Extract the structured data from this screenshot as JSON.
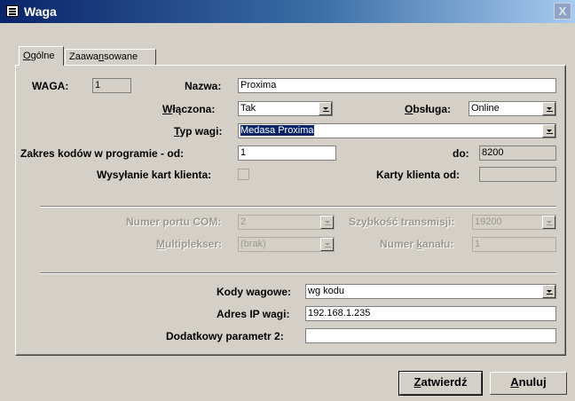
{
  "window": {
    "title": "Waga",
    "close_glyph": "X",
    "app_icon": "form-icon"
  },
  "tabs": [
    {
      "label": "Ogólne",
      "underline": "O",
      "rest": "gólne",
      "active": true
    },
    {
      "label": "Zaawansowane",
      "pre": "Zaawa",
      "underline": "n",
      "post": "sowane",
      "active": false
    }
  ],
  "general": {
    "waga_label": "WAGA:",
    "waga_value": "1",
    "nazwa_label": "Nazwa:",
    "nazwa_value": "Proxima",
    "wlaczona_label": "Włączona:",
    "wlaczona_underline": "W",
    "wlaczona_rest": "łączona:",
    "wlaczona_value": "Tak",
    "obsluga_label": "Obsługa:",
    "obsluga_underline": "O",
    "obsluga_rest": "bsługa:",
    "obsluga_value": "Online",
    "typ_label": "Typ wagi:",
    "typ_underline": "T",
    "typ_rest": "yp wagi:",
    "typ_value": "Medasa Proxima",
    "zakres_label": "Zakres kodów w programie - od:",
    "zakres_od_value": "1",
    "do_label": "do:",
    "do_value": "8200",
    "wysylanie_label": "Wysyłanie kart klienta:",
    "karty_label": "Karty klienta od:",
    "karty_value": ""
  },
  "comm": {
    "port_label": "Numer portu COM:",
    "port_value": "2",
    "speed_label_pre": "Sz",
    "speed_label_u": "y",
    "speed_label_post": "bkość transmisji:",
    "speed_value": "19200",
    "mux_label_u": "M",
    "mux_label_post": "ultiplekser:",
    "mux_value": "(brak)",
    "channel_label_pre": "Numer ",
    "channel_label_u": "k",
    "channel_label_post": "anału:",
    "channel_value": "1"
  },
  "weights": {
    "kody_label": "Kody wagowe:",
    "kody_value": "wg kodu",
    "ip_label": "Adres IP wagi:",
    "ip_value": "192.168.1.235",
    "param_label": "Dodatkowy parametr 2:",
    "param_value": ""
  },
  "buttons": {
    "confirm_u": "Z",
    "confirm_rest": "atwierdź",
    "cancel_u": "A",
    "cancel_rest": "nuluj"
  }
}
